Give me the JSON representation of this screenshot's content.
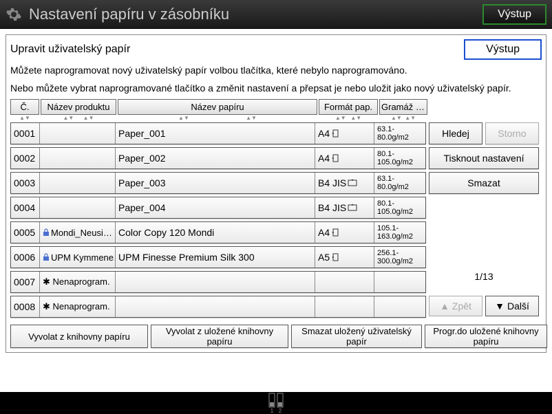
{
  "title": "Nastavení papíru v zásobníku",
  "exit_top": "Výstup",
  "panel_title": "Upravit uživatelský papír",
  "output_btn": "Výstup",
  "instruction1": "Můžete naprogramovat nový uživatelský papír volbou tlačítka, které nebylo naprogramováno.",
  "instruction2": "Nebo můžete vybrat naprogramované tlačítko a změnit nastavení a přepsat je nebo uložit jako nový uživatelský papír.",
  "headers": {
    "no": "Č.",
    "product": "Název produktu",
    "name": "Název papíru",
    "format": "Formát pap.",
    "gram": "Gramáž pap."
  },
  "rows": [
    {
      "no": "0001",
      "product": "",
      "name": "Paper_001",
      "format": "A4",
      "orient": "portrait",
      "gram": "63.1- 80.0g/m2",
      "locked": false
    },
    {
      "no": "0002",
      "product": "",
      "name": "Paper_002",
      "format": "A4",
      "orient": "portrait",
      "gram": "80.1- 105.0g/m2",
      "locked": false
    },
    {
      "no": "0003",
      "product": "",
      "name": "Paper_003",
      "format": "B4 JIS",
      "orient": "landscape",
      "gram": "63.1- 80.0g/m2",
      "locked": false
    },
    {
      "no": "0004",
      "product": "",
      "name": "Paper_004",
      "format": "B4 JIS",
      "orient": "landscape",
      "gram": "80.1- 105.0g/m2",
      "locked": false
    },
    {
      "no": "0005",
      "product": "Mondi_Neusi…",
      "name": "Color Copy 120 Mondi",
      "format": "A4",
      "orient": "portrait",
      "gram": "105.1- 163.0g/m2",
      "locked": true
    },
    {
      "no": "0006",
      "product": "UPM Kymmene…",
      "name": "UPM Finesse Premium Silk 300",
      "format": "A5",
      "orient": "portrait",
      "gram": "256.1- 300.0g/m2",
      "locked": true
    },
    {
      "no": "0007",
      "product": "✱ Nenaprogram.",
      "name": "",
      "format": "",
      "orient": "",
      "gram": "",
      "locked": false
    },
    {
      "no": "0008",
      "product": "✱ Nenaprogram.",
      "name": "",
      "format": "",
      "orient": "",
      "gram": "",
      "locked": false
    }
  ],
  "actions": {
    "search": "Hledej",
    "cancel": "Storno",
    "print_settings": "Tisknout nastavení",
    "delete": "Smazat"
  },
  "pager": {
    "label": "1/13",
    "prev": "Zpět",
    "next": "Další"
  },
  "bottom": {
    "recall_lib": "Vyvolat z knihovny papíru",
    "recall_saved": "Vyvolat z uložené knihovny papíru",
    "delete_saved": "Smazat uložený uživatelský papír",
    "prog_saved": "Progr.do uložené knihovny papíru"
  },
  "tray_labels": {
    "t1": "1",
    "t2": "2"
  }
}
